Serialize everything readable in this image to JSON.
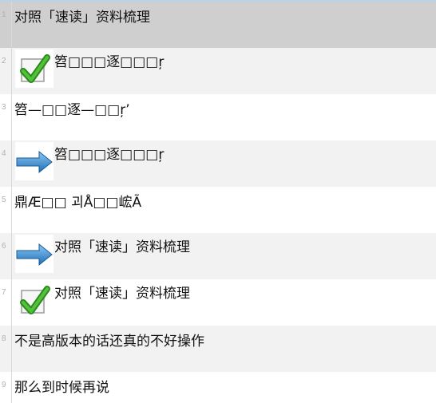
{
  "rows": [
    {
      "num": "1",
      "text": "对照「速读」资料梳理",
      "icon": "",
      "bg": "#cfcfcf"
    },
    {
      "num": "2",
      "text": "笤□□□逐□□□ŗ",
      "icon": "checkmark-icon",
      "bg": "#f2f2f2"
    },
    {
      "num": "3",
      "text": "笤—□□逐—□□ŗ’",
      "icon": "",
      "bg": "#ffffff"
    },
    {
      "num": "4",
      "text": "笤□□□逐□□□ŗ",
      "icon": "arrow-right-icon",
      "bg": "#f2f2f2"
    },
    {
      "num": "5",
      "text": "鼎Æ□□ 괴Å□□峵Ã",
      "icon": "",
      "bg": "#ffffff"
    },
    {
      "num": "6",
      "text": "对照「速读」资料梳理",
      "icon": "arrow-right-icon",
      "bg": "#f2f2f2"
    },
    {
      "num": "7",
      "text": "对照「速读」资料梳理",
      "icon": "checkmark-icon",
      "bg": "#ffffff"
    },
    {
      "num": "8",
      "text": "不是高版本的话还真的不好操作",
      "icon": "",
      "bg": "#f2f2f2"
    },
    {
      "num": "9",
      "text": "那么到时候再说",
      "icon": "",
      "bg": "#ffffff"
    }
  ]
}
